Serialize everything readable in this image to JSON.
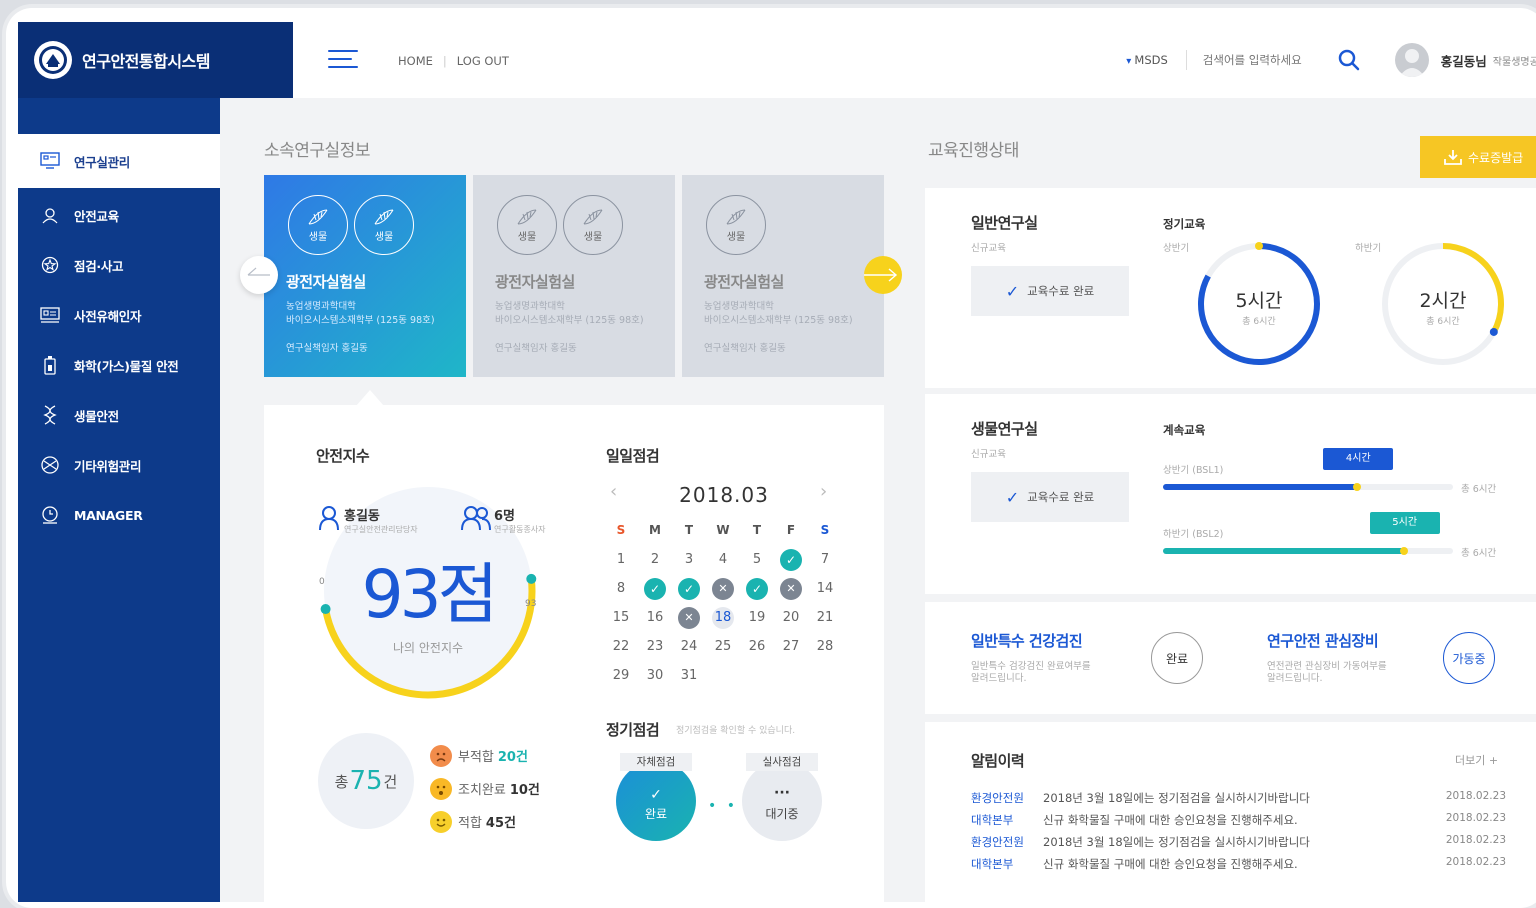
{
  "app": {
    "title": "연구안전통합시스템"
  },
  "topbar": {
    "home": "HOME",
    "logout": "LOG OUT",
    "msds": "MSDS",
    "search_placeholder": "검색어를 입력하세요",
    "user_name": "홍길동님",
    "user_dept": "작물생명공학"
  },
  "sidebar": {
    "items": [
      {
        "label": "연구실관리",
        "icon": "monitor-icon"
      },
      {
        "label": "안전교육",
        "icon": "user-shield-icon"
      },
      {
        "label": "점검·사고",
        "icon": "badge-icon"
      },
      {
        "label": "사전유해인자",
        "icon": "board-icon"
      },
      {
        "label": "화학(가스)물질 안전",
        "icon": "gas-icon"
      },
      {
        "label": "생물안전",
        "icon": "dna-icon"
      },
      {
        "label": "기타위험관리",
        "icon": "hazard-icon"
      },
      {
        "label": "MANAGER",
        "icon": "clock-icon"
      }
    ]
  },
  "lab_section": {
    "title": "소속연구실정보"
  },
  "labs": [
    {
      "badges": [
        "생물",
        "생물"
      ],
      "name": "광전자실험실",
      "dept1": "농업생명과학대학",
      "dept2": "바이오시스템소재학부 (125동 98호)",
      "pi": "연구실책임자 홍길동"
    },
    {
      "badges": [
        "생물",
        "생물"
      ],
      "name": "광전자실험실",
      "dept1": "농업생명과학대학",
      "dept2": "바이오시스템소재학부 (125동 98호)",
      "pi": "연구실책임자 홍길동"
    },
    {
      "badges": [
        "생물"
      ],
      "name": "광전자실험실",
      "dept1": "농업생명과학대학",
      "dept2": "바이오시스템소재학부 (125동 98호)",
      "pi": "연구실책임자 홍길동"
    }
  ],
  "safety": {
    "title": "안전지수",
    "manager_name": "홍길동",
    "manager_role": "연구실안전관리담당자",
    "workers": "6명",
    "workers_role": "연구활동종사자",
    "score": "93점",
    "score_label": "나의 안전지수",
    "gauge_min": "0",
    "gauge_max": "93",
    "score_fraction": 0.93,
    "total_prefix": "총",
    "total_count": "75",
    "total_suffix": "건",
    "items": [
      {
        "label": "부적합",
        "count": "20건",
        "color": "#f28c4b"
      },
      {
        "label": "조치완료",
        "count": "10건",
        "color": "#f9b826"
      },
      {
        "label": "적합",
        "count": "45건",
        "color": "#f7cf2b"
      }
    ]
  },
  "daily": {
    "title": "일일점검",
    "month": "2018.03",
    "prev": "‹",
    "next": "›",
    "weekdays": [
      "S",
      "M",
      "T",
      "W",
      "T",
      "F",
      "S"
    ],
    "weeks": [
      [
        {
          "d": "1"
        },
        {
          "d": "2"
        },
        {
          "d": "3"
        },
        {
          "d": "4"
        },
        {
          "d": "5"
        },
        {
          "d": "6",
          "s": "ok"
        },
        {
          "d": "7"
        }
      ],
      [
        {
          "d": "8"
        },
        {
          "d": "9",
          "s": "ok"
        },
        {
          "d": "10",
          "s": "ok"
        },
        {
          "d": "11",
          "s": "x"
        },
        {
          "d": "12",
          "s": "ok"
        },
        {
          "d": "13",
          "s": "x"
        },
        {
          "d": "14"
        }
      ],
      [
        {
          "d": "15"
        },
        {
          "d": "16"
        },
        {
          "d": "17",
          "s": "x"
        },
        {
          "d": "18",
          "s": "today"
        },
        {
          "d": "19"
        },
        {
          "d": "20"
        },
        {
          "d": "21"
        }
      ],
      [
        {
          "d": "22"
        },
        {
          "d": "23"
        },
        {
          "d": "24"
        },
        {
          "d": "25"
        },
        {
          "d": "26"
        },
        {
          "d": "27"
        },
        {
          "d": "28"
        }
      ],
      [
        {
          "d": "29"
        },
        {
          "d": "30"
        },
        {
          "d": "31"
        }
      ]
    ]
  },
  "regular": {
    "title": "정기점검",
    "sub": "정기점검을 확인할 수 있습니다.",
    "self_label": "자체점검",
    "self_status": "완료",
    "real_label": "실사점검",
    "real_status": "대기중"
  },
  "edu": {
    "title": "교육진행상태",
    "cert_button": "수료증발급",
    "general": {
      "title": "일반연구실",
      "sub": "신규교육",
      "done": "교육수료 완료",
      "section": "정기교육",
      "first": {
        "label": "상반기",
        "value": "5시간",
        "total": "총 6시간",
        "fraction": 0.83
      },
      "second": {
        "label": "하반기",
        "value": "2시간",
        "total": "총 6시간",
        "fraction": 0.33
      }
    },
    "bio": {
      "title": "생물연구실",
      "sub": "신규교육",
      "done": "교육수료 완료",
      "section": "계속교육",
      "first": {
        "label": "상반기 (BSL1)",
        "tag": "4시간",
        "total": "총 6시간",
        "fraction": 0.67
      },
      "second": {
        "label": "하반기 (BSL2)",
        "tag": "5시간",
        "total": "총 6시간",
        "fraction": 0.83
      }
    }
  },
  "health": {
    "title": "일반특수 건강검진",
    "desc1": "일반특수 검강검진 완료여부를",
    "desc2": "알려드립니다.",
    "status": "완료"
  },
  "equip": {
    "title": "연구안전 관심장비",
    "desc1": "연전관련 관심장비 가동여부를",
    "desc2": "알려드립니다.",
    "status": "가동중"
  },
  "notices": {
    "title": "알림이력",
    "more": "더보기 +",
    "rows": [
      {
        "src": "환경안전원",
        "text": "2018년 3월 18일에는 정기점검을 실시하시기바랍니다",
        "date": "2018.02.23"
      },
      {
        "src": "대학본부",
        "text": "신규 화학물질 구매에 대한 승인요청을 진행해주세요.",
        "date": "2018.02.23"
      },
      {
        "src": "환경안전원",
        "text": "2018년 3월 18일에는 정기점검을 실시하시기바랍니다",
        "date": "2018.02.23"
      },
      {
        "src": "대학본부",
        "text": "신규 화학물질 구매에 대한 승인요청을 진행해주세요.",
        "date": "2018.02.23"
      }
    ]
  },
  "colors": {
    "navy": "#0d3a8a",
    "accent": "#1b58d4",
    "yellow": "#f7d21c",
    "teal": "#1ab3b0"
  }
}
